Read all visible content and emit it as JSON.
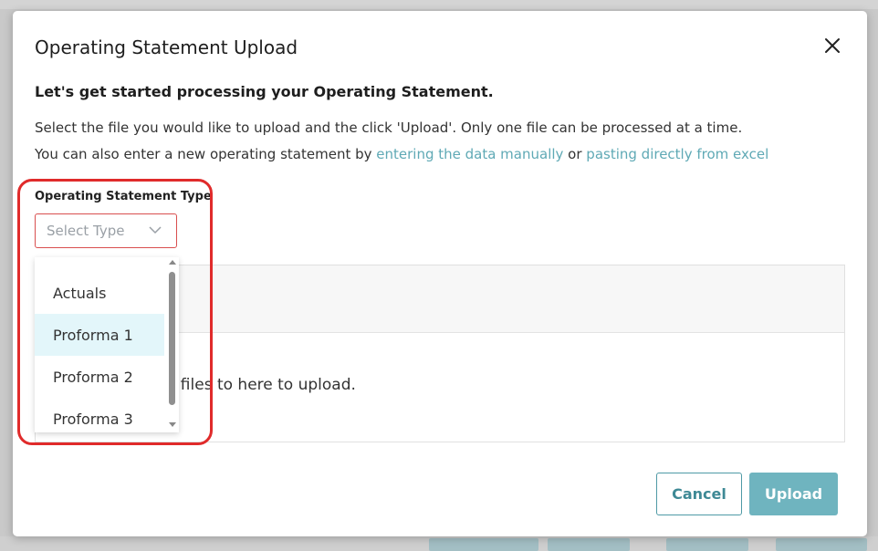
{
  "modal": {
    "title": "Operating Statement Upload",
    "heading": "Let's get started processing your Operating Statement.",
    "instructions": "Select the file you would like to upload and the click 'Upload'. Only one file can be processed at a time.",
    "alt_text_prefix": "You can also enter a new operating statement by ",
    "alt_link_manual": "entering the data manually",
    "alt_text_or": " or ",
    "alt_link_excel": "pasting directly from excel"
  },
  "type_select": {
    "label": "Operating Statement Type",
    "placeholder": "Select Type",
    "options": [
      "Actuals",
      "Proforma 1",
      "Proforma 2",
      "Proforma 3"
    ],
    "highlighted": "Proforma 1"
  },
  "dropzone": {
    "text": "o files to here to upload."
  },
  "buttons": {
    "cancel": "Cancel",
    "upload": "Upload"
  },
  "colors": {
    "accent": "#5fa9b5",
    "annotation": "#e02b2b",
    "upload_bg": "#6fb4bf"
  },
  "icons": {
    "close": "close-icon",
    "chevron": "chevron-down-icon"
  }
}
